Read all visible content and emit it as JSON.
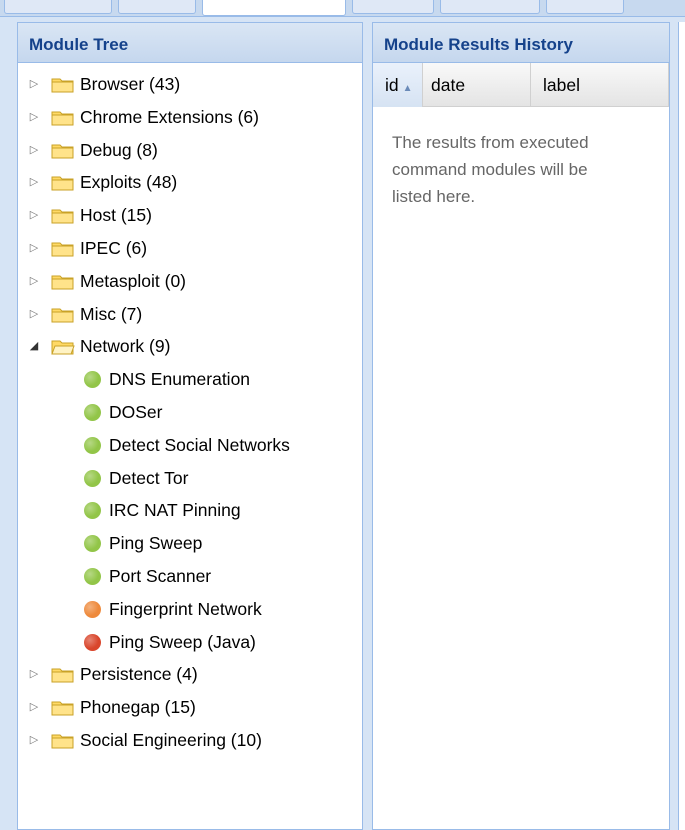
{
  "tree_panel": {
    "title": "Module Tree",
    "folders_before": [
      {
        "label": "Browser (43)"
      },
      {
        "label": "Chrome Extensions (6)"
      },
      {
        "label": "Debug (8)"
      },
      {
        "label": "Exploits (48)"
      },
      {
        "label": "Host (15)"
      },
      {
        "label": "IPEC (6)"
      },
      {
        "label": "Metasploit (0)"
      },
      {
        "label": "Misc (7)"
      }
    ],
    "expanded_folder": {
      "label": "Network (9)",
      "children": [
        {
          "label": "DNS Enumeration",
          "status_color": "#92c548"
        },
        {
          "label": "DOSer",
          "status_color": "#92c548"
        },
        {
          "label": "Detect Social Networks",
          "status_color": "#92c548"
        },
        {
          "label": "Detect Tor",
          "status_color": "#92c548"
        },
        {
          "label": "IRC NAT Pinning",
          "status_color": "#92c548"
        },
        {
          "label": "Ping Sweep",
          "status_color": "#92c548"
        },
        {
          "label": "Port Scanner",
          "status_color": "#92c548"
        },
        {
          "label": "Fingerprint Network",
          "status_color": "#ee8a3c"
        },
        {
          "label": "Ping Sweep (Java)",
          "status_color": "#d9452b"
        }
      ]
    },
    "folders_after": [
      {
        "label": "Persistence (4)"
      },
      {
        "label": "Phonegap (15)"
      },
      {
        "label": "Social Engineering (10)"
      }
    ]
  },
  "results_panel": {
    "title": "Module Results History",
    "columns": {
      "id": "id",
      "date": "date",
      "label": "label"
    },
    "empty_message": "The results from executed command modules will be listed here."
  },
  "colors": {
    "header_text": "#15428b",
    "border": "#99bbe8",
    "folder_fill": "#ffd966",
    "folder_stroke": "#c9a227"
  }
}
